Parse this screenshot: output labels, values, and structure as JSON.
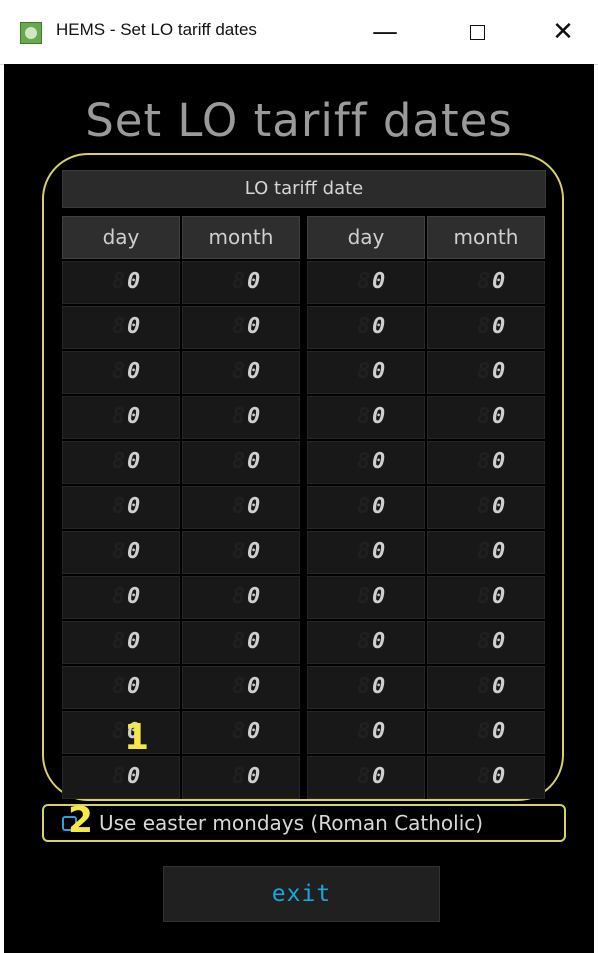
{
  "window": {
    "title": "HEMS - Set LO tariff dates",
    "minimize_glyph": "—",
    "close_glyph": "✕"
  },
  "page": {
    "heading": "Set LO tariff dates",
    "table_title": "LO tariff date",
    "columns": [
      "day",
      "month",
      "day",
      "month"
    ],
    "ghost_digit": "8",
    "left_rows": [
      [
        "0",
        "0"
      ],
      [
        "0",
        "0"
      ],
      [
        "0",
        "0"
      ],
      [
        "0",
        "0"
      ],
      [
        "0",
        "0"
      ],
      [
        "0",
        "0"
      ],
      [
        "0",
        "0"
      ],
      [
        "0",
        "0"
      ],
      [
        "0",
        "0"
      ],
      [
        "0",
        "0"
      ],
      [
        "0",
        "0"
      ],
      [
        "0",
        "0"
      ]
    ],
    "right_rows": [
      [
        "0",
        "0"
      ],
      [
        "0",
        "0"
      ],
      [
        "0",
        "0"
      ],
      [
        "0",
        "0"
      ],
      [
        "0",
        "0"
      ],
      [
        "0",
        "0"
      ],
      [
        "0",
        "0"
      ],
      [
        "0",
        "0"
      ],
      [
        "0",
        "0"
      ],
      [
        "0",
        "0"
      ],
      [
        "0",
        "0"
      ],
      [
        "0",
        "0"
      ]
    ],
    "checkbox_label": "Use easter mondays (Roman Catholic)",
    "checkbox_checked": false,
    "exit_label": "exit"
  },
  "annotations": {
    "marker_1": "1",
    "marker_2": "2",
    "color": "#f5e84a",
    "box_color": "#d8d06a"
  }
}
